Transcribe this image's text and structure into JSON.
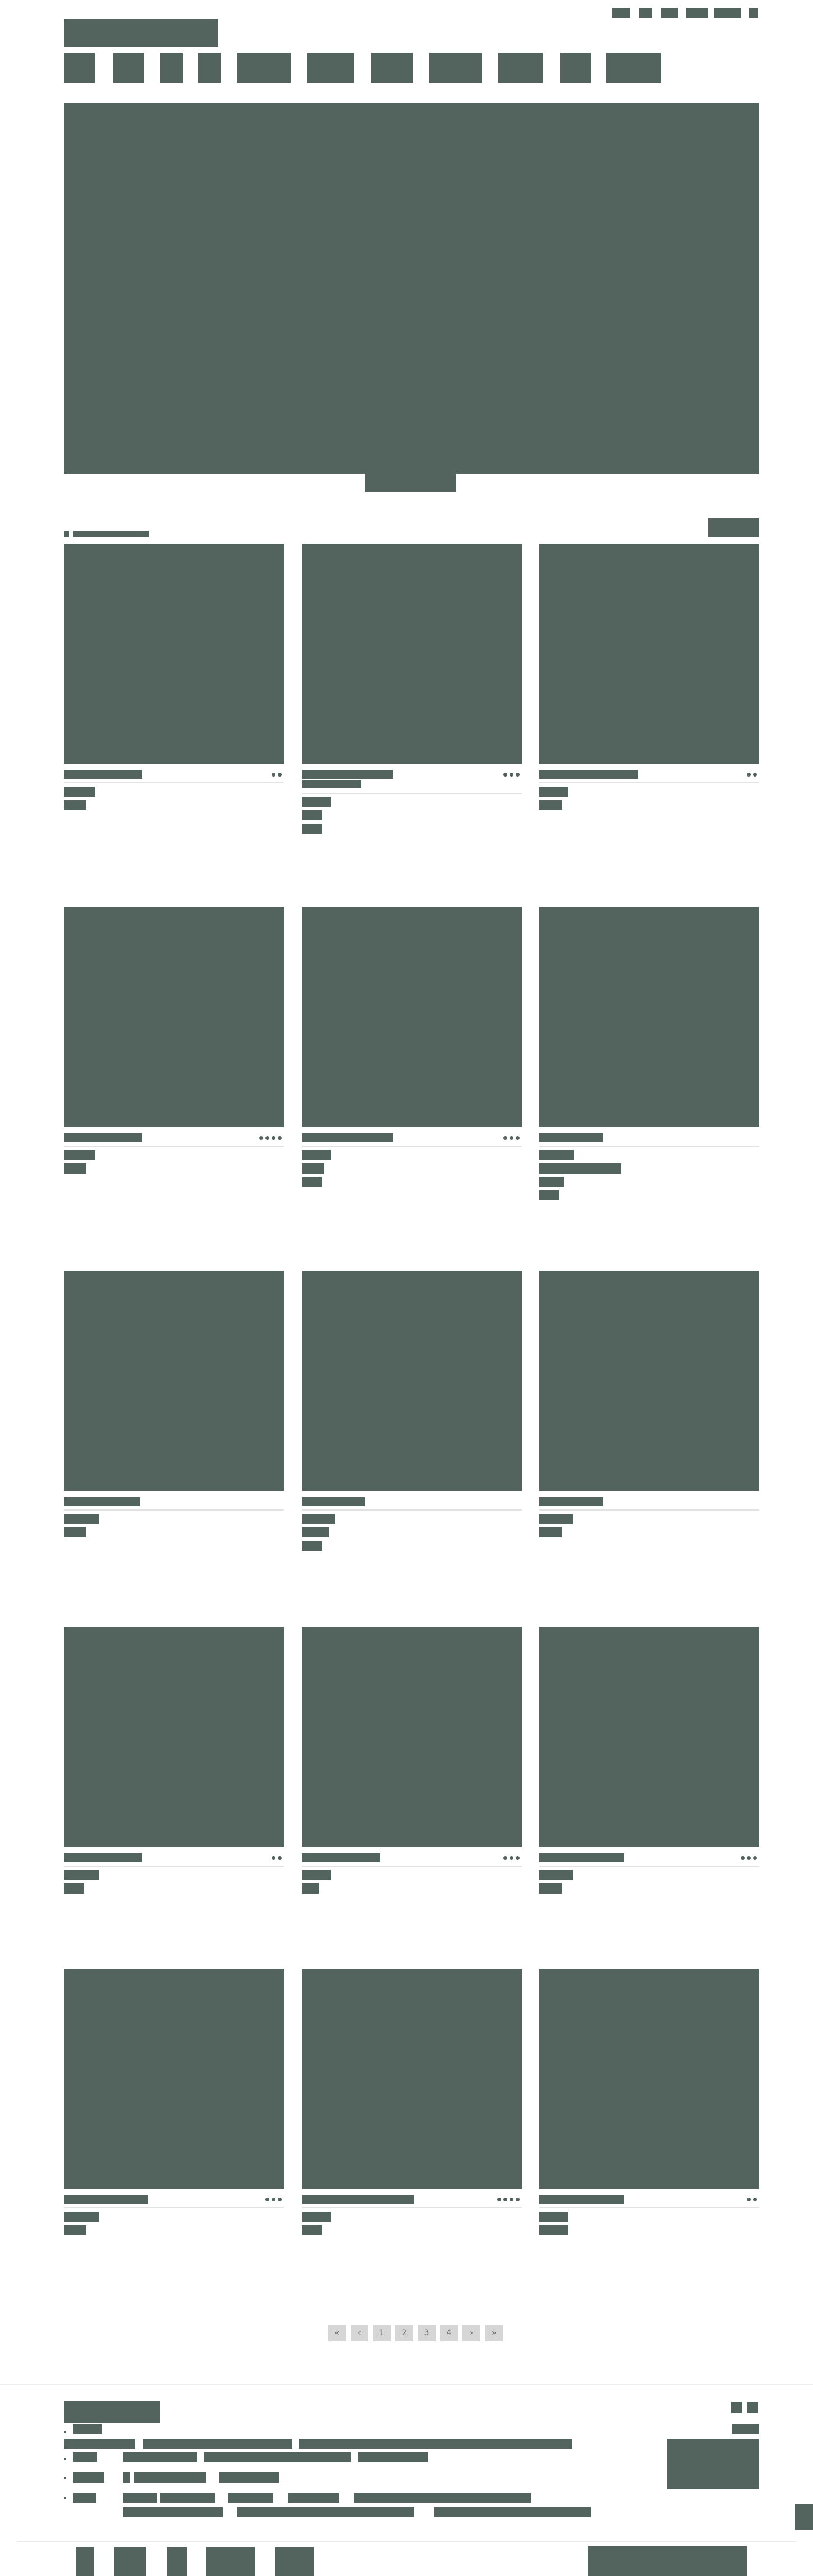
{
  "header": {
    "logo": "",
    "utility_links": [
      "",
      "",
      "",
      "",
      "",
      ""
    ],
    "nav_items": [
      "",
      "",
      "",
      "",
      "",
      "",
      "",
      "",
      "",
      "",
      ""
    ]
  },
  "hero": {
    "image": "placeholder-image",
    "caption": ""
  },
  "listing": {
    "breadcrumb": "",
    "sort_button": "",
    "cards": [
      {
        "title": "",
        "dots": 2,
        "meta": [
          "",
          ""
        ]
      },
      {
        "title": "",
        "dots": 3,
        "meta": [
          "",
          "",
          ""
        ]
      },
      {
        "title": "",
        "dots": 2,
        "meta": [
          "",
          ""
        ]
      },
      {
        "title": "",
        "dots": 4,
        "meta": [
          "",
          ""
        ]
      },
      {
        "title": "",
        "dots": 3,
        "meta": [
          "",
          "",
          ""
        ]
      },
      {
        "title": "",
        "dots": 0,
        "meta": [
          "",
          "",
          "",
          ""
        ]
      },
      {
        "title": "",
        "dots": 0,
        "meta": [
          "",
          ""
        ]
      },
      {
        "title": "",
        "dots": 0,
        "meta": [
          "",
          "",
          ""
        ]
      },
      {
        "title": "",
        "dots": 0,
        "meta": [
          "",
          ""
        ]
      },
      {
        "title": "",
        "dots": 2,
        "meta": [
          "",
          ""
        ]
      },
      {
        "title": "",
        "dots": 3,
        "meta": [
          "",
          ""
        ]
      },
      {
        "title": "",
        "dots": 3,
        "meta": [
          "",
          ""
        ]
      },
      {
        "title": "",
        "dots": 3,
        "meta": [
          "",
          ""
        ]
      },
      {
        "title": "",
        "dots": 4,
        "meta": [
          "",
          ""
        ]
      },
      {
        "title": "",
        "dots": 2,
        "meta": [
          "",
          ""
        ]
      }
    ]
  },
  "pagination": {
    "first": "«",
    "prev": "‹",
    "pages": [
      "1",
      "2",
      "3",
      "4"
    ],
    "next": "›",
    "last": "»"
  },
  "footer": {
    "heading": "",
    "social_icons": [
      "",
      ""
    ],
    "links": [
      "",
      "",
      "",
      "",
      "",
      "",
      "",
      "",
      "",
      "",
      "",
      "",
      "",
      "",
      "",
      "",
      "",
      ""
    ],
    "bottom_items": [
      "",
      "",
      "",
      "",
      "",
      ""
    ]
  }
}
